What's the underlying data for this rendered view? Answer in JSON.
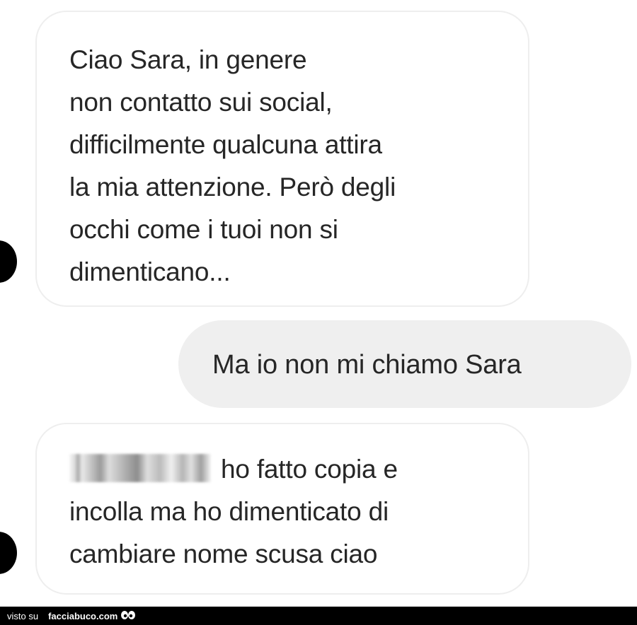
{
  "messages": [
    {
      "direction": "incoming",
      "lines": [
        "Ciao Sara, in genere",
        "non contatto sui social,",
        "difficilmente qualcuna attira",
        "la mia attenzione. Però degli",
        "occhi come i tuoi non si",
        "dimenticano..."
      ]
    },
    {
      "direction": "outgoing",
      "text": "Ma io non mi chiamo Sara"
    },
    {
      "direction": "incoming",
      "redacted_sender": true,
      "lines": [
        "ho fatto copia e",
        "incolla ma ho dimenticato di",
        "cambiare nome scusa ciao"
      ]
    }
  ],
  "watermark": {
    "prefix": "visto su",
    "site": "facciabuco.com"
  },
  "colors": {
    "text": "#262626",
    "incoming_bubble_border": "#eeeeee",
    "outgoing_bubble_bg": "#efefef",
    "footer_bg": "#000000"
  }
}
